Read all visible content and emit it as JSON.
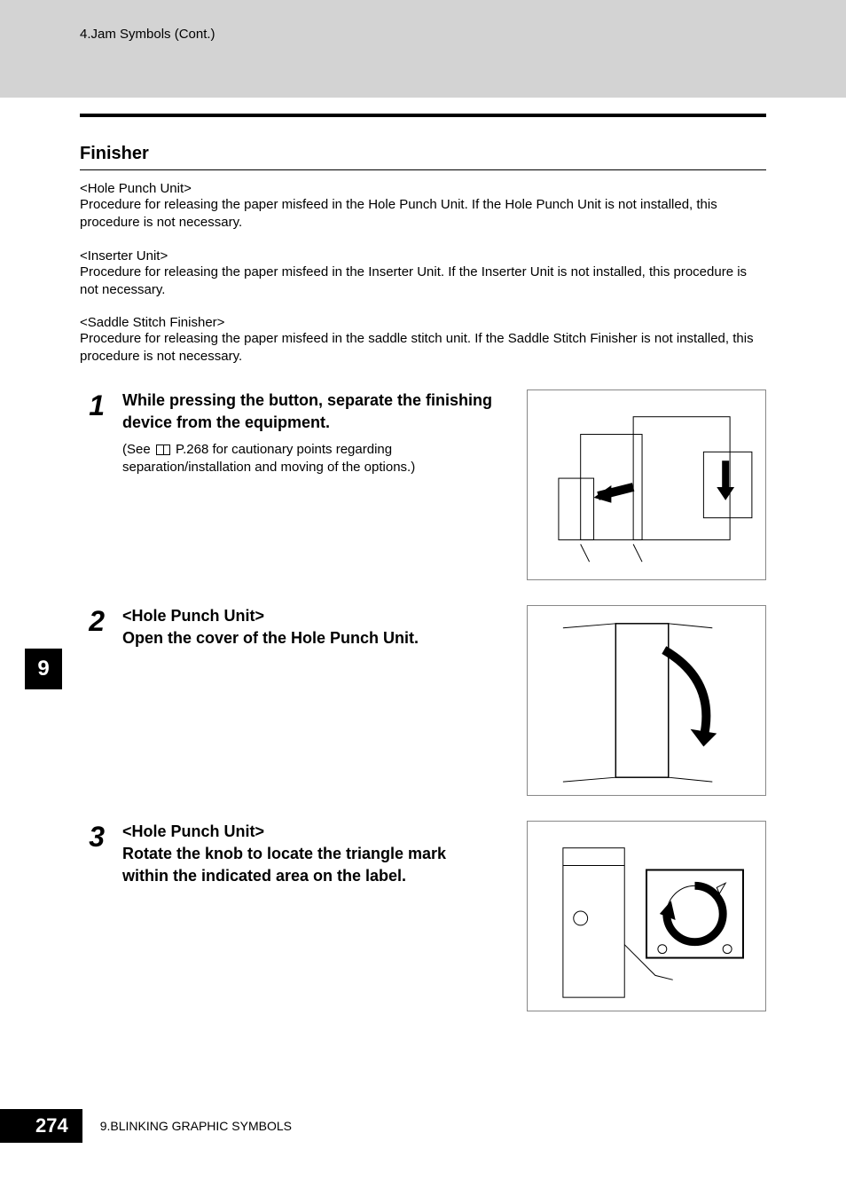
{
  "header": {
    "breadcrumb": "4.Jam Symbols (Cont.)"
  },
  "section": {
    "title": "Finisher",
    "intro": [
      {
        "label": "<Hole Punch Unit>",
        "text": "Procedure for releasing the paper misfeed in the Hole Punch Unit. If the Hole Punch Unit is not installed, this procedure is not necessary."
      },
      {
        "label": "<Inserter Unit>",
        "text": "Procedure for releasing the paper misfeed in the Inserter Unit. If the Inserter Unit is not installed, this procedure is not necessary."
      },
      {
        "label": "<Saddle Stitch Finisher>",
        "text": "Procedure for releasing the paper misfeed in the saddle stitch unit. If the Saddle Stitch Finisher is not installed, this procedure is not necessary."
      }
    ],
    "steps": [
      {
        "number": "1",
        "title": "While pressing the button, separate the finishing device from the equipment.",
        "note_prefix": "(See ",
        "note_ref": "P.268",
        "note_suffix": " for cautionary points regarding separation/installation and moving of the options.)"
      },
      {
        "number": "2",
        "title": "<Hole Punch Unit>\nOpen the cover of the Hole Punch Unit."
      },
      {
        "number": "3",
        "title": "<Hole Punch Unit>\nRotate the knob to locate the triangle mark within the indicated area on the label."
      }
    ]
  },
  "chapter_tab": "9",
  "footer": {
    "page_number": "274",
    "chapter_label": "9.BLINKING GRAPHIC SYMBOLS"
  }
}
